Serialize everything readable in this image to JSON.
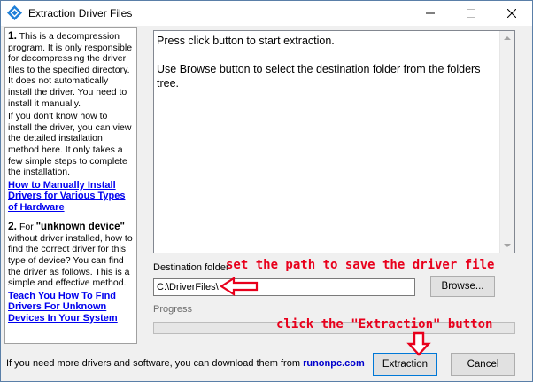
{
  "window": {
    "title": "Extraction Driver Files"
  },
  "left_panel": {
    "section1": {
      "number": "1.",
      "intro": "This is a decompression program. It is only responsible for decompressing the driver files to the specified directory. It does not automatically install the driver. You need to install it manually.",
      "detail": "If you don't know how to install the driver, you can view the detailed installation method here. It only takes a few simple steps to complete the installation.",
      "link": "How to Manually Install Drivers for Various Types of Hardware"
    },
    "section2": {
      "number": "2.",
      "prefix": "For",
      "emphasis": "\"unknown device\"",
      "text": "without driver installed, how to find the correct driver for this type of device? You can find the driver as follows. This is a simple and effective method.",
      "link": "Teach You How To Find Drivers For Unknown Devices In Your System"
    }
  },
  "info_box": {
    "text": "Press click button to start extraction.\n\nUse Browse button to select the destination folder from the folders tree."
  },
  "destination": {
    "label": "Destination folder",
    "value": "C:\\DriverFiles\\",
    "browse_label": "Browse..."
  },
  "progress": {
    "label": "Progress",
    "value": 0
  },
  "footer": {
    "text": "If you need more drivers and software, you can download them from",
    "link": "runonpc.com"
  },
  "buttons": {
    "extraction": "Extraction",
    "cancel": "Cancel"
  },
  "annotations": {
    "path_note": "set the path to save the driver file",
    "extract_note": "click the \"Extraction\" button"
  },
  "colors": {
    "annotation": "#e8001c",
    "link": "#0000ee",
    "title_icon": "#1e7fd8"
  },
  "icons": {
    "app": "blue-diamond-icon",
    "minimize": "minimize-icon",
    "maximize": "maximize-icon",
    "close": "close-icon"
  }
}
